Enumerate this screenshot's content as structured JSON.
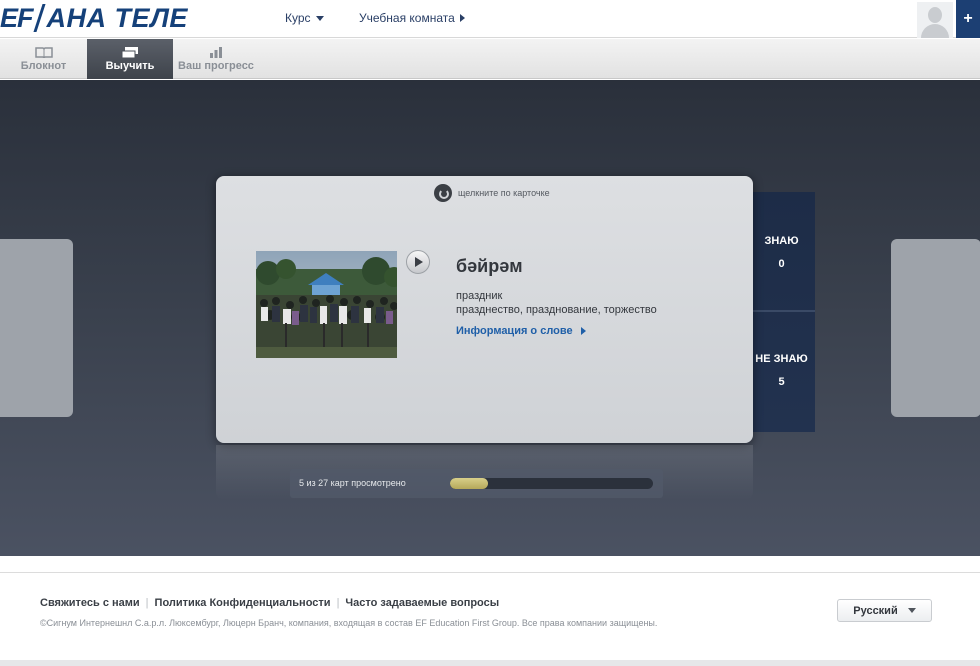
{
  "header": {
    "logo_ef": "EF",
    "logo_text": "АНА ТЕЛЕ",
    "nav": [
      {
        "label": "Курс"
      },
      {
        "label": "Учебная комната"
      }
    ],
    "plus_label": "+"
  },
  "tabs": [
    {
      "label": "Блокнот",
      "icon": "notebook-icon",
      "active": false
    },
    {
      "label": "Выучить",
      "icon": "cards-icon",
      "active": true
    },
    {
      "label": "Ваш прогресс",
      "icon": "bar-chart-icon",
      "active": false
    }
  ],
  "flashcard": {
    "hint": "щелкните по карточке",
    "word": "бәйрәм",
    "translation_line1": "праздник",
    "translation_line2": "празднество, празднование, торжество",
    "word_info_link": "Информация о слове"
  },
  "score": {
    "known_label": "ЗНАЮ",
    "known_count": "0",
    "unknown_label": "НЕ ЗНАЮ",
    "unknown_count": "5"
  },
  "progress": {
    "text": "5 из 27 карт просмотрено",
    "viewed": 5,
    "total": 27
  },
  "footer": {
    "links": [
      "Свяжитесь с нами",
      "Политика Конфиденциальности",
      "Часто задаваемые вопросы"
    ],
    "copyright": "©Сигнум Интернешнл С.а.р.л. Люксембург, Люцерн Бранч, компания, входящая в состав EF Education First Group. Все права компании защищены.",
    "language": "Русский"
  },
  "colors": {
    "brand": "#15417a",
    "link": "#1f5fa8",
    "progress_fill": "#c9be70",
    "score_panel": "#1d2c47"
  }
}
